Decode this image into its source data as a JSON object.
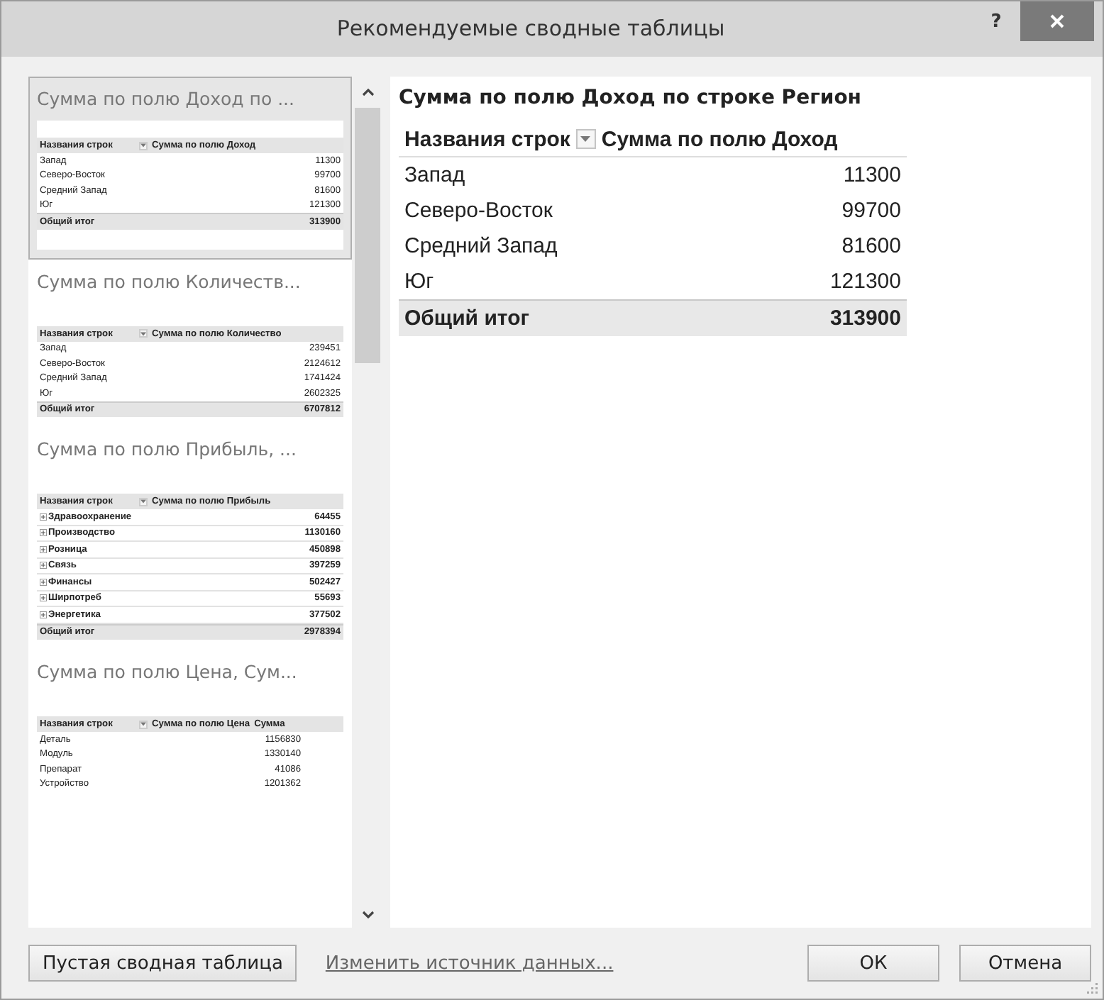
{
  "window": {
    "title": "Рекомендуемые сводные таблицы",
    "help": "?"
  },
  "cards": [
    {
      "title": "Сумма по полю Доход по ...",
      "selected": true,
      "columns": [
        "Названия строк",
        "Сумма по полю Доход"
      ],
      "rows": [
        {
          "label": "Запад",
          "values": [
            "11300"
          ],
          "expandable": false
        },
        {
          "label": "Северо-Восток",
          "values": [
            "99700"
          ],
          "expandable": false
        },
        {
          "label": "Средний Запад",
          "values": [
            "81600"
          ],
          "expandable": false
        },
        {
          "label": "Юг",
          "values": [
            "121300"
          ],
          "expandable": false
        }
      ],
      "total": {
        "label": "Общий итог",
        "values": [
          "313900"
        ]
      }
    },
    {
      "title": "Сумма по полю Количеств...",
      "selected": false,
      "columns": [
        "Названия строк",
        "Сумма по полю Количество"
      ],
      "rows": [
        {
          "label": "Запад",
          "values": [
            "239451"
          ],
          "expandable": false
        },
        {
          "label": "Северо-Восток",
          "values": [
            "2124612"
          ],
          "expandable": false
        },
        {
          "label": "Средний Запад",
          "values": [
            "1741424"
          ],
          "expandable": false
        },
        {
          "label": "Юг",
          "values": [
            "2602325"
          ],
          "expandable": false
        }
      ],
      "total": {
        "label": "Общий итог",
        "values": [
          "6707812"
        ]
      }
    },
    {
      "title": "Сумма по полю Прибыль, ...",
      "selected": false,
      "columns": [
        "Названия строк",
        "Сумма по полю Прибыль"
      ],
      "rows": [
        {
          "label": "Здравоохранение",
          "values": [
            "64455"
          ],
          "expandable": true
        },
        {
          "label": "Производство",
          "values": [
            "1130160"
          ],
          "expandable": true
        },
        {
          "label": "Розница",
          "values": [
            "450898"
          ],
          "expandable": true
        },
        {
          "label": "Связь",
          "values": [
            "397259"
          ],
          "expandable": true
        },
        {
          "label": "Финансы",
          "values": [
            "502427"
          ],
          "expandable": true
        },
        {
          "label": "Ширпотреб",
          "values": [
            "55693"
          ],
          "expandable": true
        },
        {
          "label": "Энергетика",
          "values": [
            "377502"
          ],
          "expandable": true
        }
      ],
      "total": {
        "label": "Общий итог",
        "values": [
          "2978394"
        ]
      }
    },
    {
      "title": "Сумма по полю Цена, Сум...",
      "selected": false,
      "columns": [
        "Названия строк",
        "Сумма по полю Цена",
        "Сумма"
      ],
      "rows": [
        {
          "label": "Деталь",
          "values": [
            "1156830"
          ],
          "expandable": false
        },
        {
          "label": "Модуль",
          "values": [
            "1330140"
          ],
          "expandable": false
        },
        {
          "label": "Препарат",
          "values": [
            "41086"
          ],
          "expandable": false
        },
        {
          "label": "Устройство",
          "values": [
            "1201362"
          ],
          "expandable": false
        }
      ]
    }
  ],
  "preview": {
    "title": "Сумма по полю Доход по строке Регион",
    "columns": [
      "Названия строк",
      "Сумма по полю Доход"
    ],
    "rows": [
      {
        "label": "Запад",
        "value": "11300"
      },
      {
        "label": "Северо-Восток",
        "value": "99700"
      },
      {
        "label": "Средний Запад",
        "value": "81600"
      },
      {
        "label": "Юг",
        "value": "121300"
      }
    ],
    "total": {
      "label": "Общий итог",
      "value": "313900"
    }
  },
  "footer": {
    "blank_button": "Пустая сводная таблица",
    "change_source_link": "Изменить источник данных...",
    "ok_button": "ОК",
    "cancel_button": "Отмена"
  }
}
